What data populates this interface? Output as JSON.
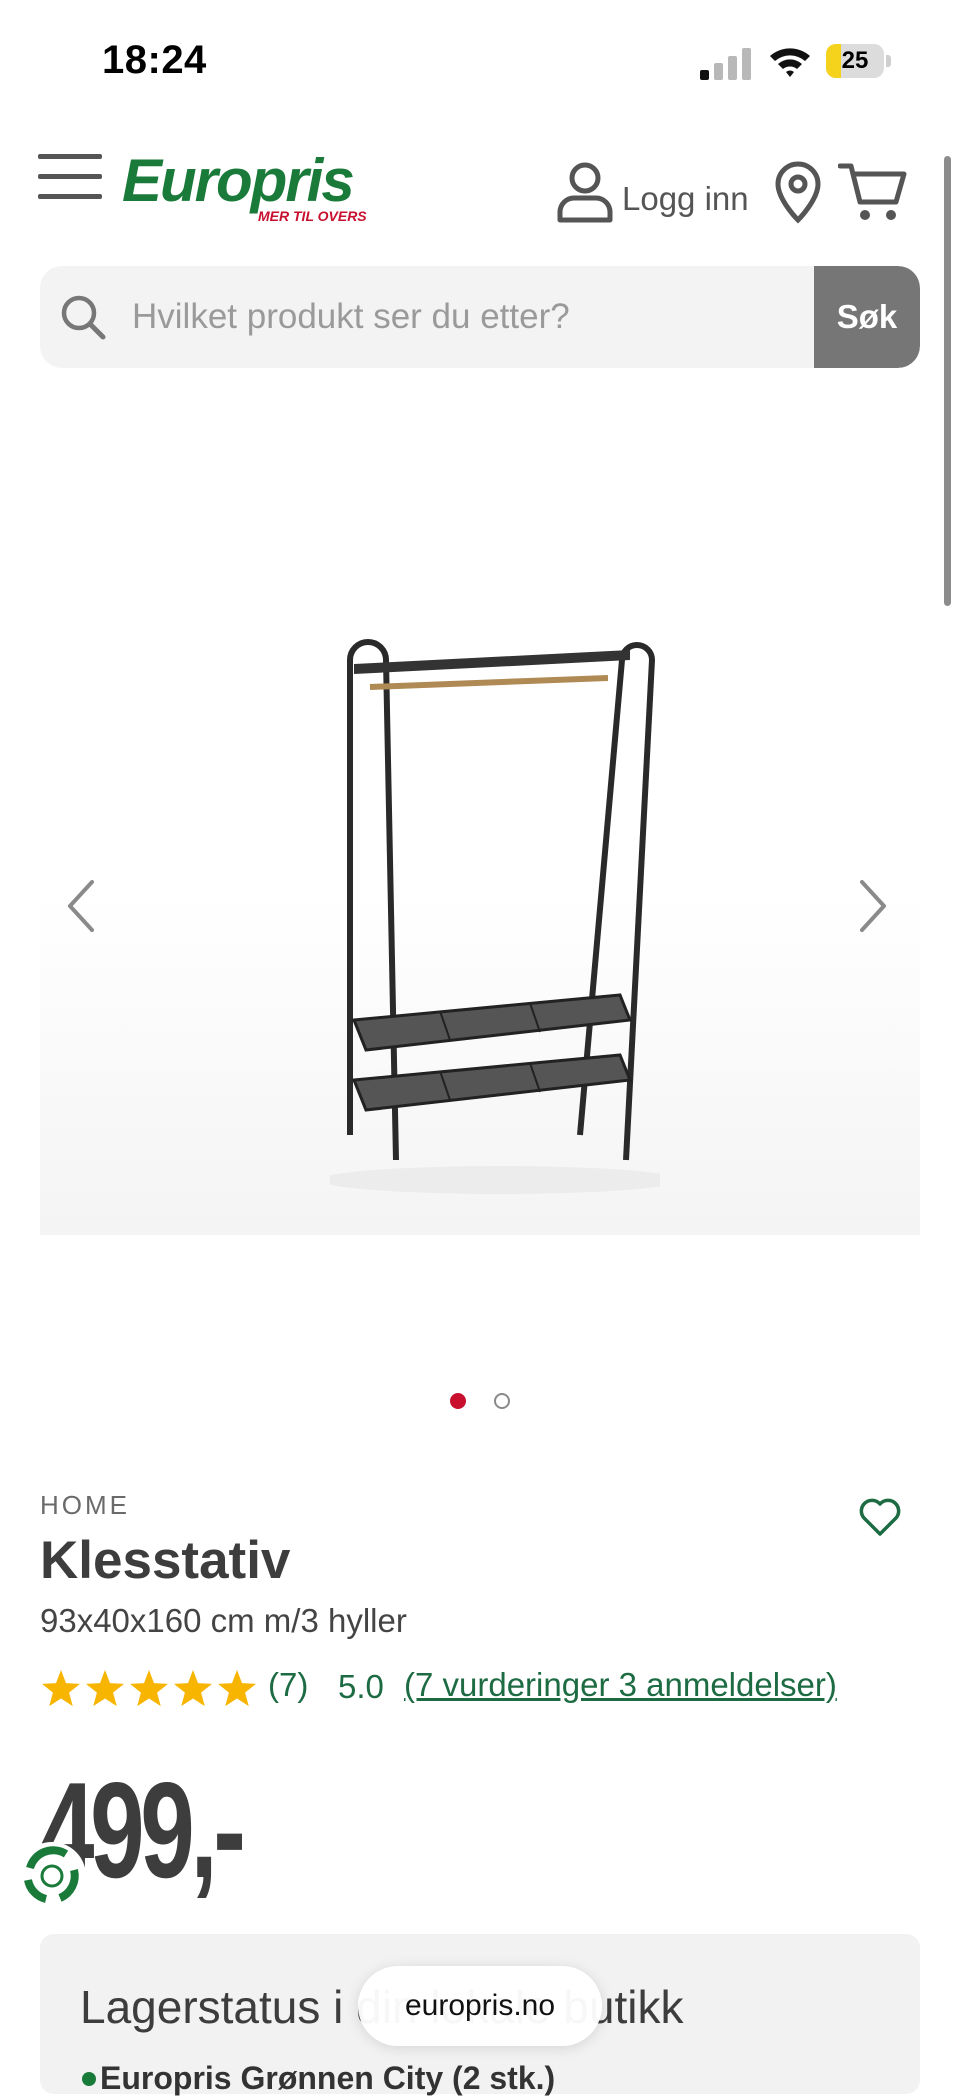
{
  "status_bar": {
    "time": "18:24",
    "battery_level": "25",
    "battery_fraction": 0.25
  },
  "header": {
    "logo_text": "Europris",
    "logo_tagline": "MER TIL OVERS",
    "login_label": "Logg inn",
    "icons": [
      "menu-icon",
      "user-icon",
      "location-pin-icon",
      "cart-icon"
    ]
  },
  "search": {
    "placeholder": "Hvilket produkt ser du etter?",
    "value": "",
    "submit_label": "Søk"
  },
  "gallery": {
    "image_count": 2,
    "active_index": 0
  },
  "product": {
    "brand": "HOME",
    "title": "Klesstativ",
    "subtitle": "93x40x160 cm m/3 hyller",
    "rating_stars": 5,
    "review_count": "(7)",
    "rating_score": "5.0",
    "reviews_link": "(7 vurderinger 3 anmeldelser)",
    "price": "499,-"
  },
  "stock": {
    "title": "Lagerstatus i din lokale butikk",
    "store_line": "Europris Grønnen City (2 stk.)"
  },
  "browser": {
    "url": "europris.no"
  },
  "colors": {
    "brand_green": "#1a7a3a",
    "brand_red": "#c8102e",
    "link_green": "#1d6b43",
    "star_yellow": "#f7b500",
    "search_button": "#767676"
  }
}
